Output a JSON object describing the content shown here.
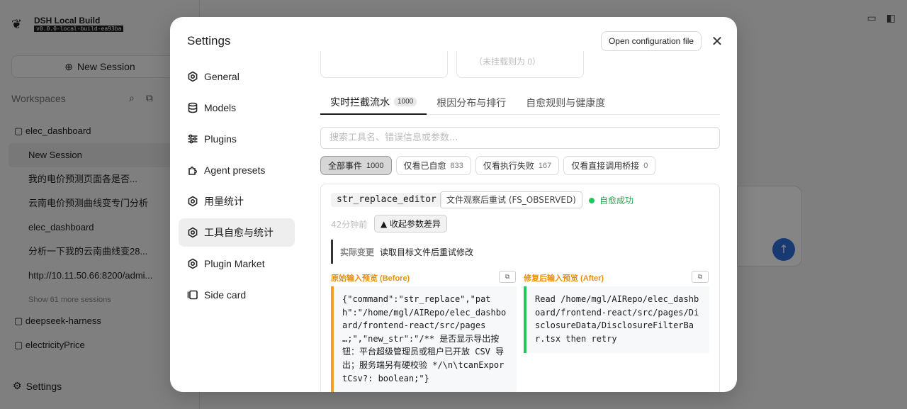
{
  "background": {
    "brand_title": "DSH Local Build",
    "brand_sub": "v0.0.0-local-build-ea93ba",
    "new_session": "New Session",
    "workspaces_label": "Workspaces",
    "items": [
      {
        "label": "elec_dashboard",
        "kind": "folder"
      },
      {
        "label": "New Session",
        "kind": "active"
      },
      {
        "label": "我的电价预测页面各是否...",
        "kind": "session"
      },
      {
        "label": "云南电价预测曲线变专门分析",
        "kind": "session"
      },
      {
        "label": "elec_dashboard",
        "kind": "session"
      },
      {
        "label": "分析一下我的云南曲线变28...",
        "kind": "session"
      },
      {
        "label": "http://10.11.50.66:8200/admi...",
        "kind": "session"
      },
      {
        "label": "Show 61 more sessions",
        "kind": "more"
      },
      {
        "label": "deepseek-harness",
        "kind": "folder"
      },
      {
        "label": "electricityPrice",
        "kind": "folder"
      }
    ],
    "settings": "Settings"
  },
  "modal": {
    "title": "Settings",
    "open_config": "Open configuration file",
    "close_icon": "close-icon",
    "nav": [
      {
        "label": "General",
        "icon": "gear-icon"
      },
      {
        "label": "Models",
        "icon": "database-icon"
      },
      {
        "label": "Plugins",
        "icon": "sliders-icon"
      },
      {
        "label": "Agent presets",
        "icon": "puzzle-icon"
      },
      {
        "label": "用量统计",
        "icon": "gear-icon"
      },
      {
        "label": "工具自愈与统计",
        "icon": "gear-icon",
        "active": true
      },
      {
        "label": "Plugin Market",
        "icon": "gear-icon"
      },
      {
        "label": "Side card",
        "icon": "side-card-icon"
      }
    ]
  },
  "content": {
    "stat_note": "（未挂载则为 0）",
    "tabs": [
      {
        "label": "实时拦截流水",
        "count": "1000",
        "active": true
      },
      {
        "label": "根因分布与排行",
        "count": null
      },
      {
        "label": "自愈规则与健康度",
        "count": null
      }
    ],
    "search_placeholder": "搜索工具名、错误信息或参数...",
    "filters": [
      {
        "label": "全部事件",
        "count": "1000",
        "active": true
      },
      {
        "label": "仅看已自愈",
        "count": "833"
      },
      {
        "label": "仅看执行失败",
        "count": "167"
      },
      {
        "label": "仅看直接调用桥接",
        "count": "0"
      }
    ],
    "event": {
      "tool": "str_replace_editor",
      "type": "文件观察后重试 (FS_OBSERVED)",
      "status": "自愈成功",
      "status_color": "#22c55e",
      "time_ago": "42分钟前",
      "collapse": "▲ 收起参数差异",
      "change_label": "实际变更",
      "change_value": "读取目标文件后重试修改",
      "before_title": "原始输入预览 (Before)",
      "after_title": "修复后输入预览 (After)",
      "before_code": "{\"command\":\"str_replace\",\"path\":\"/home/mgl/AIRepo/elec_dashboard/frontend-react/src/pages …;\",\"new_str\":\"/** 是否显示导出按钮：平台超级管理员或租户已开放 CSV 导出；服务端另有硬校验 */\\n\\tcanExportCsv?: boolean;\"}",
      "after_code": "Read /home/mgl/AIRepo/elec_dashboard/frontend-react/src/pages/DisclosureData/DisclosureFilterBar.tsx then retry",
      "copy_glyph": "⧉"
    }
  }
}
